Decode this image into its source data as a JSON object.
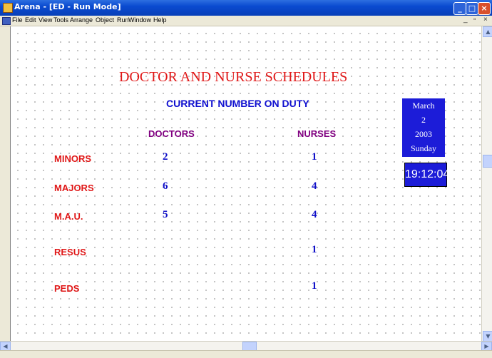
{
  "window": {
    "title": "Arena - [ED - Run Mode]",
    "min_icon": "minimize-icon",
    "max_icon": "maximize-icon",
    "close_icon": "close-icon"
  },
  "menu": [
    "File",
    "Edit",
    "View",
    "Tools",
    "Arrange",
    "Object",
    "Run",
    "Window",
    "Help"
  ],
  "screen": {
    "title": "DOCTOR AND NURSE SCHEDULES",
    "subtitle": "CURRENT NUMBER ON DUTY",
    "col_doctors": "DOCTORS",
    "col_nurses": "NURSES",
    "rows": [
      {
        "label": "MINORS",
        "doctors": "2",
        "nurses": "1"
      },
      {
        "label": "MAJORS",
        "doctors": "6",
        "nurses": "4"
      },
      {
        "label": "M.A.U.",
        "doctors": "5",
        "nurses": "4"
      },
      {
        "label": "RESUS",
        "doctors": "",
        "nurses": "1"
      },
      {
        "label": "PEDS",
        "doctors": "",
        "nurses": "1"
      }
    ],
    "date": {
      "month": "March",
      "day": "2",
      "year": "2003",
      "weekday": "Sunday"
    },
    "clock": "19:12:04"
  },
  "colors": {
    "title_red": "#e01818",
    "subtitle_blue": "#1010d0",
    "header_purple": "#800080",
    "date_box_blue": "#1c1cd8"
  }
}
